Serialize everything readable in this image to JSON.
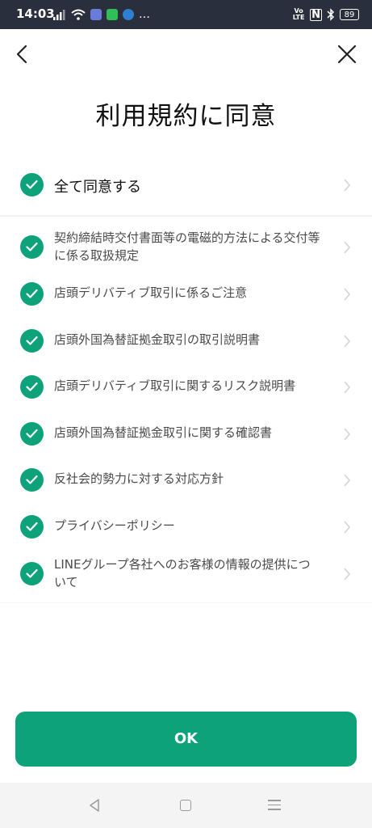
{
  "status_bar": {
    "time": "14:03",
    "volte": "Vo LTE",
    "nfc": "N",
    "battery": "89",
    "more": "…"
  },
  "header": {
    "title": "利用規約に同意"
  },
  "agree_all": {
    "label": "全て同意する",
    "checked": true
  },
  "items": [
    {
      "label": "契約締結時交付書面等の電磁的方法による交付等に係る取扱規定",
      "checked": true
    },
    {
      "label": "店頭デリバティブ取引に係るご注意",
      "checked": true
    },
    {
      "label": "店頭外国為替証拠金取引の取引説明書",
      "checked": true
    },
    {
      "label": "店頭デリバティブ取引に関するリスク説明書",
      "checked": true
    },
    {
      "label": "店頭外国為替証拠金取引に関する確認書",
      "checked": true
    },
    {
      "label": "反社会的勢力に対する対応方針",
      "checked": true
    },
    {
      "label": "プライバシーポリシー",
      "checked": true
    },
    {
      "label": "LINEグループ各社へのお客様の情報の提供について",
      "checked": true
    }
  ],
  "ok_button": {
    "label": "OK"
  },
  "colors": {
    "accent": "#0ea27b",
    "status_bar": "#2a2f3d"
  }
}
